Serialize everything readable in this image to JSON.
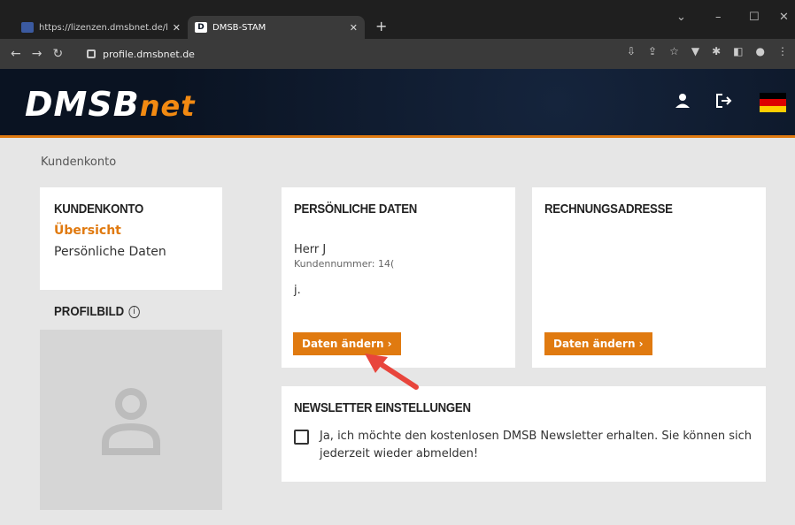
{
  "browser": {
    "tabs": [
      {
        "title": "https://lizenzen.dmsbnet.de/licer",
        "close": "✕"
      },
      {
        "title": "DMSB-STAM",
        "close": "✕"
      }
    ],
    "new_tab": "+",
    "url": "profile.dmsbnet.de"
  },
  "site": {
    "logo_main": "DMSB",
    "logo_accent": "net"
  },
  "breadcrumb": "Kundenkonto",
  "sidebar": {
    "title": "KUNDENKONTO",
    "items": [
      {
        "label": "Übersicht",
        "active": true
      },
      {
        "label": "Persönliche Daten",
        "active": false
      }
    ],
    "profile_title": "PROFILBILD",
    "info_glyph": "i"
  },
  "personal": {
    "title": "PERSÖNLICHE DATEN",
    "name": "Herr J",
    "customer_number": "Kundennummer: 14(",
    "email": "j.",
    "button": "Daten ändern ›"
  },
  "billing": {
    "title": "RECHNUNGSADRESSE",
    "button": "Daten ändern ›"
  },
  "newsletter": {
    "title": "NEWSLETTER EINSTELLUNGEN",
    "checkbox_label": "Ja, ich möchte den kostenlosen DMSB Newsletter erhalten. Sie können sich jederzeit wieder abmelden!",
    "checked": false
  },
  "colors": {
    "accent": "#e07a10",
    "header_bg": "#0a1322",
    "annotation_arrow": "#e8453c"
  }
}
